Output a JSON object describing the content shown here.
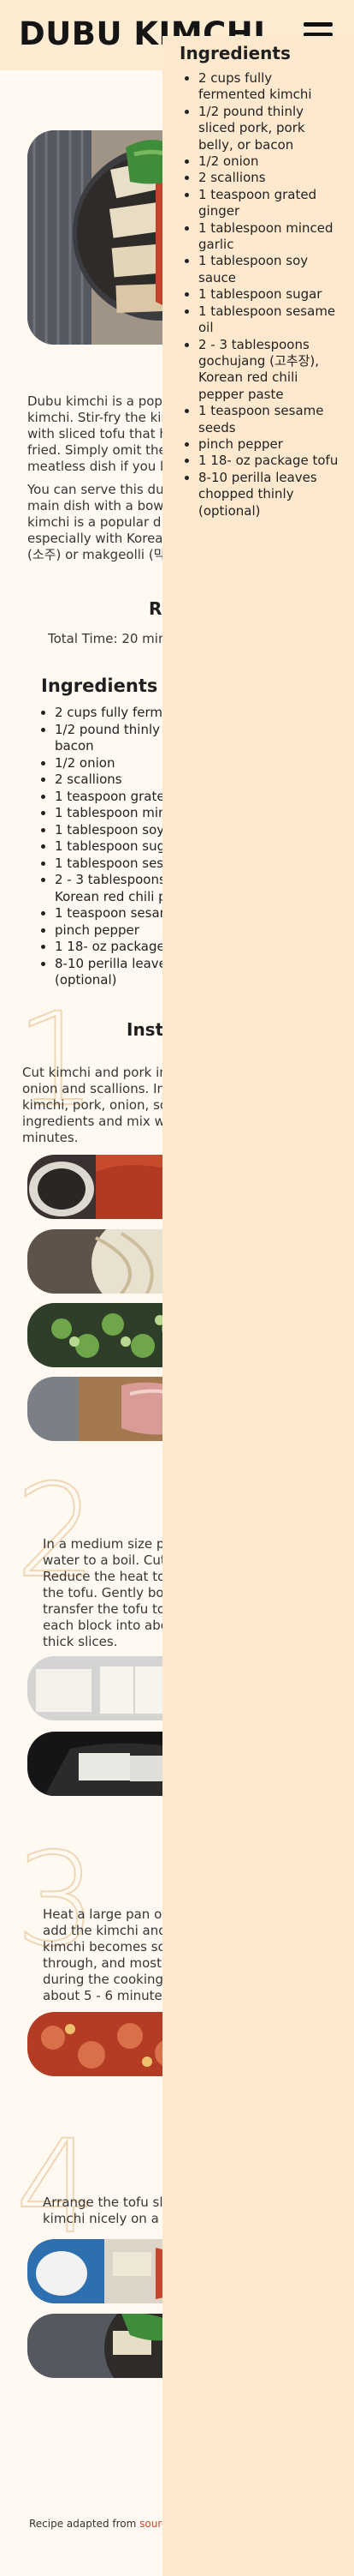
{
  "header": {
    "brand": "DUBU KIMCHI"
  },
  "intro": {
    "lines": [
      "Dubu kimchi is a pop",
      "kimchi. Stir-fry the kir",
      "with sliced tofu that h",
      "fried. Simply omit the",
      "meatless dish if you l"
    ],
    "serve_lines": [
      "You can serve this du",
      "main dish with a bow",
      "kimchi is a popular d",
      "especially with Korea",
      "(소주) or makgeolli (막"
    ]
  },
  "recipe": {
    "heading_fragment": "R",
    "total_time": "Total Time: 20 min"
  },
  "ingredients": {
    "heading": "Ingredients",
    "items": [
      "2 cups fully ferm",
      "1/2 pound thinly",
      "bacon",
      "1/2 onion",
      "2 scallions",
      "1 teaspoon grate",
      "1 tablespoon min",
      "1 tablespoon soy",
      "1 tablespoon sug",
      "1 tablespoon ses",
      "2 - 3 tablespoons",
      "Korean red chili p",
      "1 teaspoon sesam",
      "pinch pepper",
      "1 18- oz package",
      "8-10 perilla leave",
      "(optional)"
    ]
  },
  "instructions": {
    "heading_fragment": "Instr",
    "steps": [
      {
        "number": "1",
        "lines": [
          "Cut kimchi and pork in",
          "onion and scallions. In",
          "kimchi, pork, onion, sc",
          "ingredients and mix w",
          "minutes."
        ]
      },
      {
        "number": "2",
        "lines": [
          "In a medium size p",
          "water to a boil. Cut",
          "Reduce the heat to",
          "the tofu. Gently boi",
          "transfer the tofu to",
          "each block into abo",
          "thick slices."
        ]
      },
      {
        "number": "3",
        "lines": [
          "Heat a large pan o",
          "add the kimchi and",
          "kimchi becomes so",
          "through, and most",
          "during the cooking",
          "about 5 - 6 minutes"
        ]
      },
      {
        "number": "4",
        "lines": [
          "Arrange the tofu sl",
          "kimchi nicely on a"
        ]
      }
    ]
  },
  "footer": {
    "text": "Recipe adapted from ",
    "link": "sourc"
  },
  "side_panel": {
    "heading": "Ingredients",
    "items": [
      "2 cups fully fermented kimchi",
      "1/2 pound thinly sliced pork, pork belly, or bacon",
      "1/2 onion",
      "2 scallions",
      "1 teaspoon grated ginger",
      "1 tablespoon minced garlic",
      "1 tablespoon soy sauce",
      "1 tablespoon sugar",
      "1 tablespoon sesame oil",
      "2 - 3 tablespoons gochujang (고추장), Korean red chili pepper paste",
      "1 teaspoon sesame seeds",
      "pinch pepper",
      "1 18- oz package tofu",
      "8-10 perilla leaves chopped thinly (optional)"
    ]
  },
  "colors": {
    "header_bg": "#fdebd2",
    "panel_bg": "#fee9cf",
    "page_bg": "#fff9f2",
    "link": "#d2482b",
    "outline_numbers": "#efd7b5"
  }
}
